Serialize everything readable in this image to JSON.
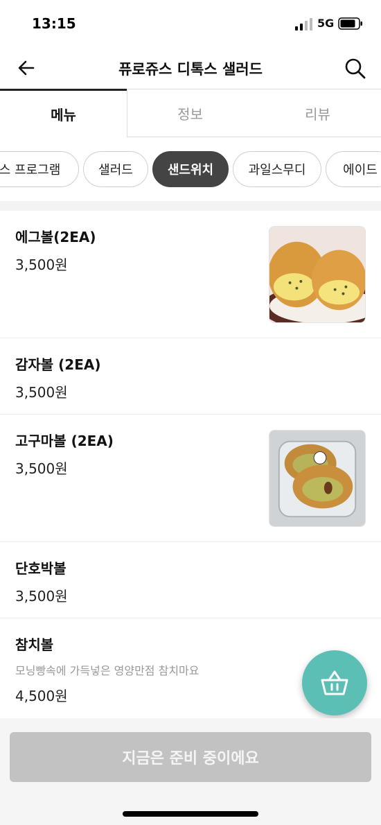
{
  "status": {
    "time": "13:15",
    "network": "5G"
  },
  "header": {
    "title": "퓨로쥬스 디톡스 샐러드"
  },
  "tabs": [
    {
      "label": "메뉴"
    },
    {
      "label": "정보"
    },
    {
      "label": "리뷰"
    }
  ],
  "categories": [
    {
      "label": "스 프로그램"
    },
    {
      "label": "샐러드"
    },
    {
      "label": "샌드위치"
    },
    {
      "label": "과일스무디"
    },
    {
      "label": "에이드"
    }
  ],
  "items": [
    {
      "name": "에그볼(2EA)",
      "price": "3,500원"
    },
    {
      "name": "감자볼 (2EA)",
      "price": "3,500원"
    },
    {
      "name": "고구마볼 (2EA)",
      "price": "3,500원"
    },
    {
      "name": "단호박볼",
      "price": "3,500원"
    },
    {
      "name": "참치볼",
      "desc": "모닝빵속에 가득넣은 영양만점 참치마요",
      "price": "4,500원"
    }
  ],
  "cta": {
    "label": "지금은 준비 중이에요"
  },
  "colors": {
    "accent": "#5cbfb6",
    "chip_active": "#444444",
    "cta_disabled": "#c2c2c2"
  }
}
